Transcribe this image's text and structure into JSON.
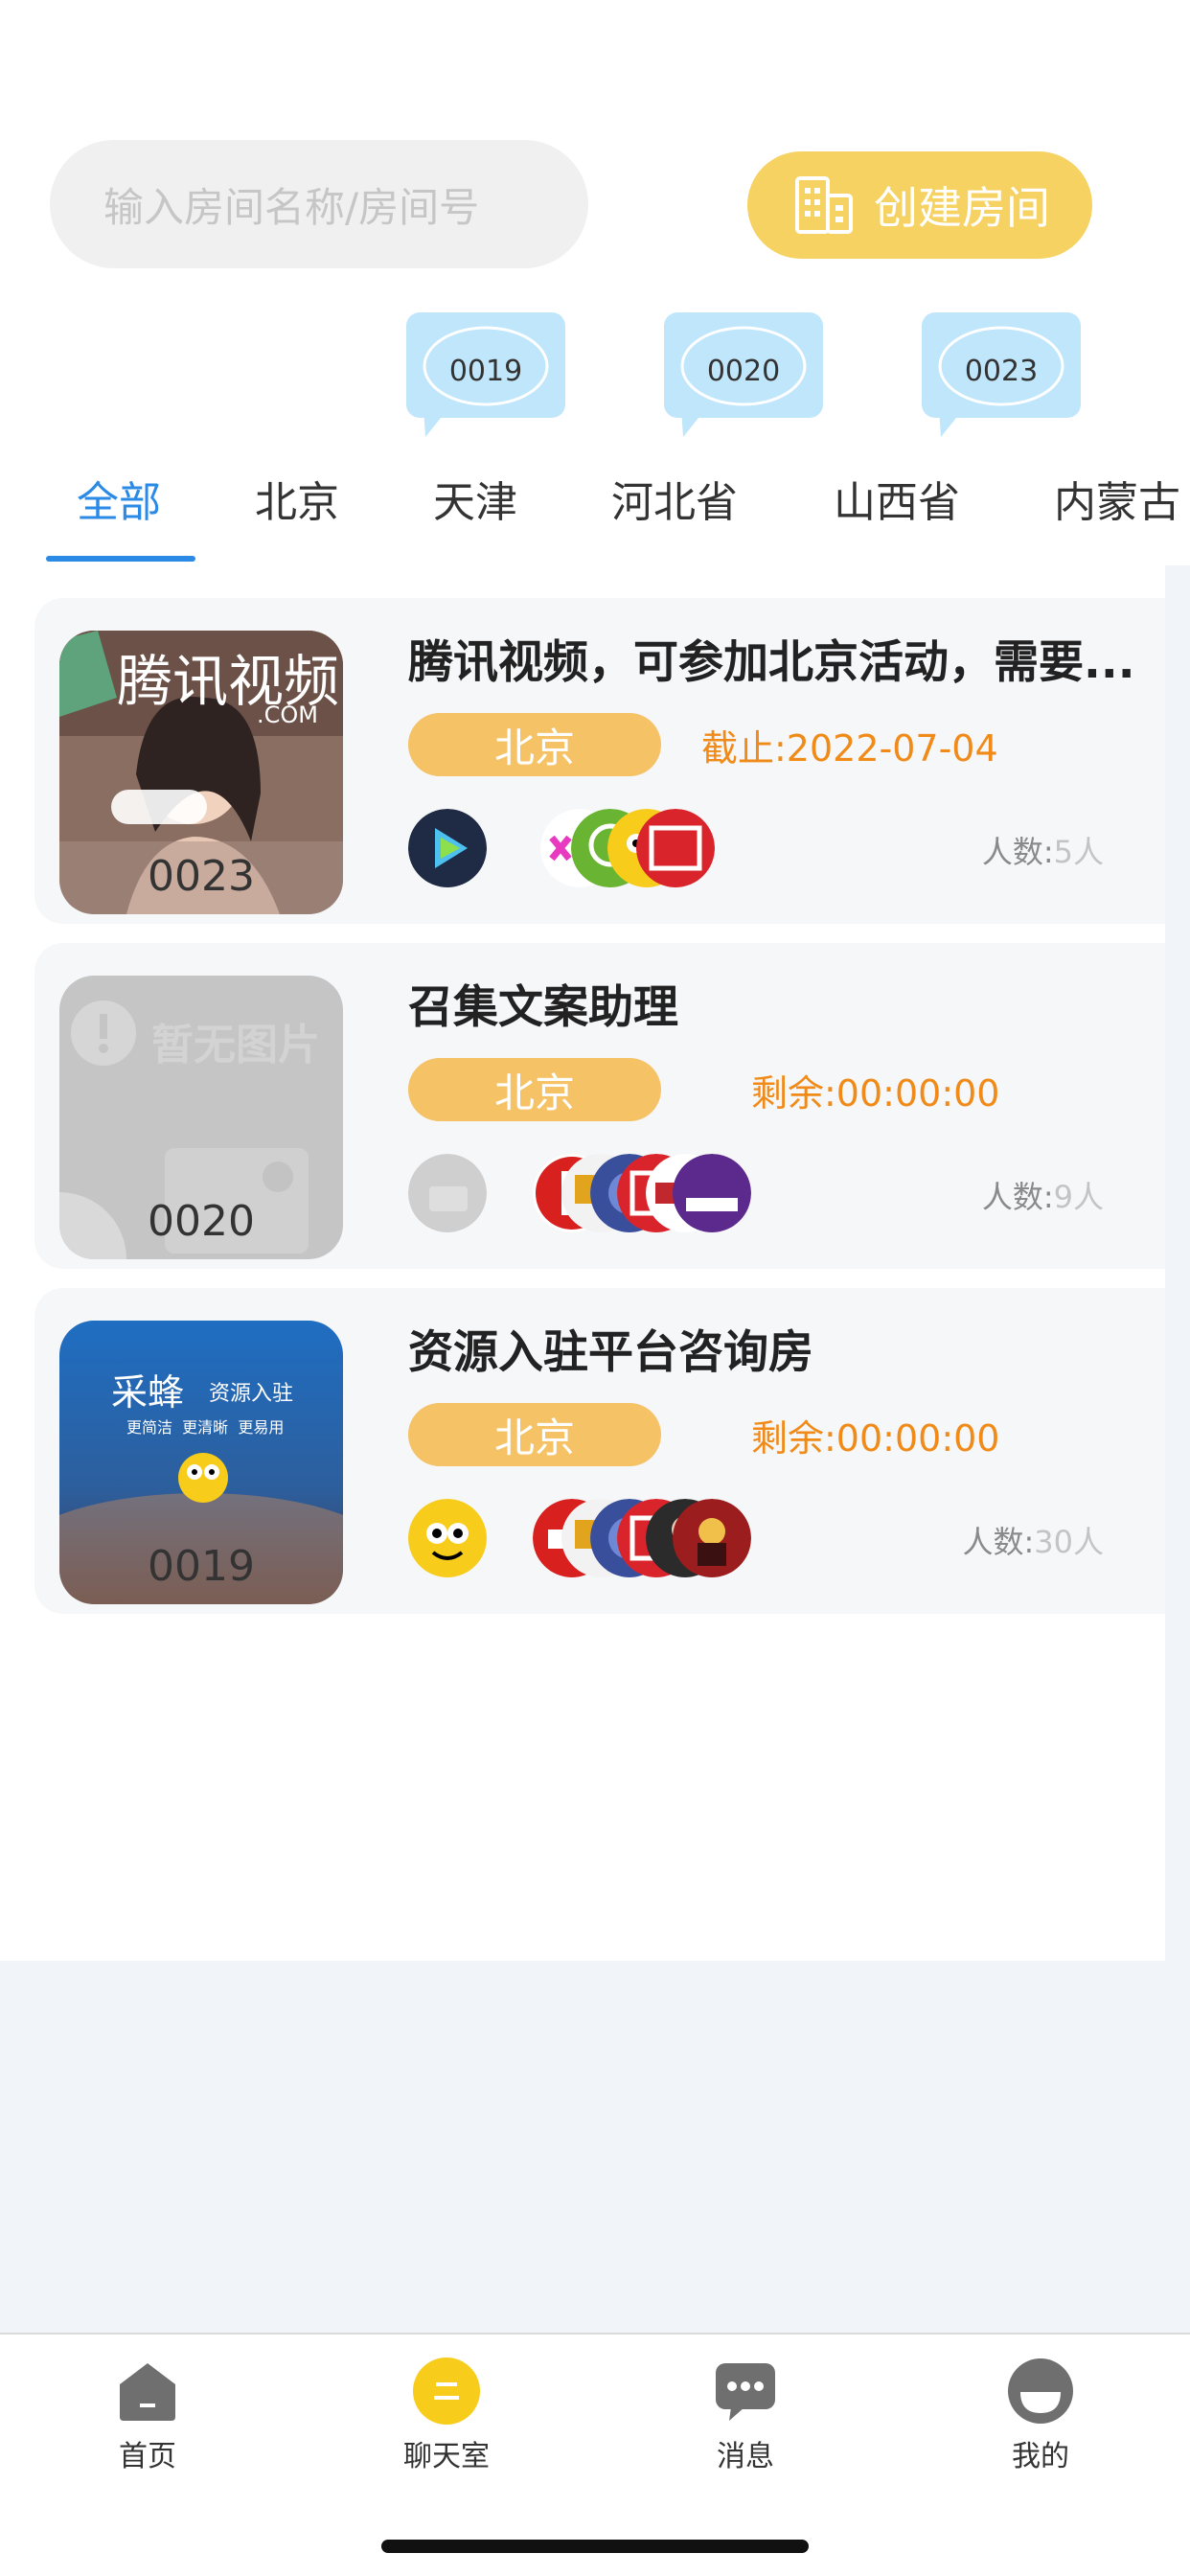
{
  "search": {
    "placeholder": "输入房间名称/房间号"
  },
  "create_room": {
    "label": "创建房间",
    "icon": "building-icon"
  },
  "bubbles": [
    {
      "code": "0019"
    },
    {
      "code": "0020"
    },
    {
      "code": "0023"
    }
  ],
  "tabs": [
    "全部",
    "北京",
    "天津",
    "河北省",
    "山西省",
    "内蒙古"
  ],
  "active_tab": "全部",
  "rooms": [
    {
      "title": "腾讯视频，可参加北京活动，需要...",
      "city": "北京",
      "time": "截止:2022-07-04",
      "code": "0023",
      "count_prefix": "人数:",
      "count": "5人",
      "thumb_text": "腾讯视频",
      "thumb_sub": ".COM"
    },
    {
      "title": "召集文案助理",
      "city": "北京",
      "time": "剩余:00:00:00",
      "code": "0020",
      "count_prefix": "人数:",
      "count": "9人",
      "thumb_text": "暂无图片"
    },
    {
      "title": "资源入驻平台咨询房",
      "city": "北京",
      "time": "剩余:00:00:00",
      "code": "0019",
      "count_prefix": "人数:",
      "count": "30人",
      "thumb_text": "采蜂",
      "thumb_sub": "资源入驻",
      "thumb_sub2": "更简洁  更清晰  更易用"
    }
  ],
  "nav": [
    {
      "label": "首页",
      "icon": "home-icon"
    },
    {
      "label": "聊天室",
      "icon": "chatroom-icon",
      "active": true
    },
    {
      "label": "消息",
      "icon": "message-icon"
    },
    {
      "label": "我的",
      "icon": "profile-icon"
    }
  ],
  "colors": {
    "accent_blue": "#2a8ae6",
    "badge_yellow": "#f5c266",
    "button_yellow": "#f6d262",
    "time_orange": "#f08a18",
    "bubble_blue": "#bfe6fb"
  }
}
